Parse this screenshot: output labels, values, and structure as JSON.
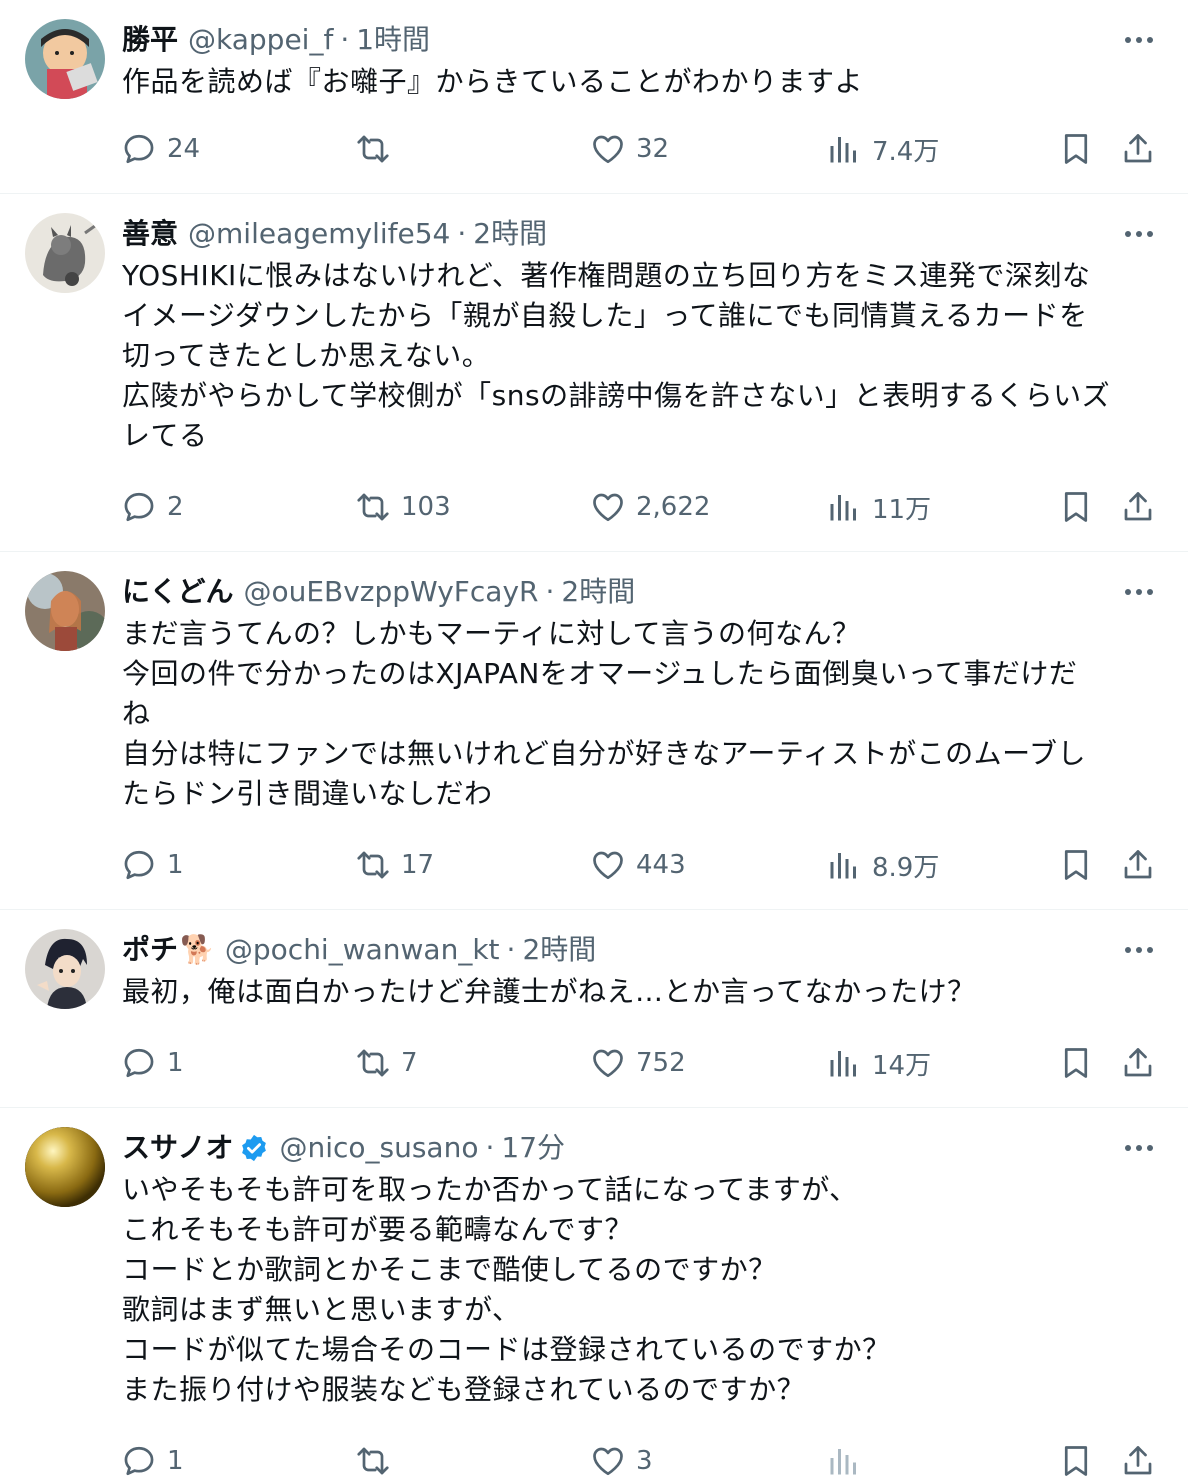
{
  "posts": [
    {
      "name": "勝平",
      "handle": "@kappei_f",
      "separator": "·",
      "time": "1時間",
      "text": "作品を読めば『お囃子』からきていることがわかりますよ",
      "replies": "24",
      "reposts": "",
      "likes": "32",
      "views": "7.4万"
    },
    {
      "name": "善意",
      "handle": "@mileagemylife54",
      "separator": "·",
      "time": "2時間",
      "text": "YOSHIKIに恨みはないけれど、著作権問題の立ち回り方をミス連発で深刻な\nイメージダウンしたから「親が自殺した」って誰にでも同情貰えるカードを\n切ってきたとしか思えない。\n広陵がやらかして学校側が「snsの誹謗中傷を許さない」と表明するくらいズ\nレてる",
      "replies": "2",
      "reposts": "103",
      "likes": "2,622",
      "views": "11万"
    },
    {
      "name": "にくどん",
      "handle": "@ouEBvzppWyFcayR",
      "separator": "·",
      "time": "2時間",
      "text": "まだ言うてんの？しかもマーティに対して言うの何なん？\n今回の件で分かったのはXJAPANをオマージュしたら面倒臭いって事だけだ\nね\n自分は特にファンでは無いけれど自分が好きなアーティストがこのムーブし\nたらドン引き間違いなしだわ",
      "replies": "1",
      "reposts": "17",
      "likes": "443",
      "views": "8.9万"
    },
    {
      "name": "ポチ",
      "emoji": "🐕",
      "handle": "@pochi_wanwan_kt",
      "separator": "·",
      "time": "2時間",
      "text": "最初，俺は面白かったけど弁護士がねえ…とか言ってなかったけ？",
      "replies": "1",
      "reposts": "7",
      "likes": "752",
      "views": "14万"
    },
    {
      "name": "スサノオ",
      "verified": true,
      "handle": "@nico_susano",
      "separator": "·",
      "time": "17分",
      "text": "いやそもそも許可を取ったか否かって話になってますが、\nこれそもそも許可が要る範疇なんです？\nコードとか歌詞とかそこまで酷使してるのですか？\n歌詞はまず無いと思いますが、\nコードが似てた場合そのコードは登録されているのですか？\nまた振り付けや服装なども登録されているのですか？",
      "replies": "1",
      "reposts": "",
      "likes": "3",
      "views": ""
    }
  ],
  "colors": {
    "text": "#0f1419",
    "secondary": "#536471",
    "divider": "#eff3f4",
    "verified": "#1d9bf0"
  },
  "icons": [
    "reply-icon",
    "repost-icon",
    "like-icon",
    "views-icon",
    "bookmark-icon",
    "share-icon",
    "more-icon",
    "verified-icon"
  ]
}
